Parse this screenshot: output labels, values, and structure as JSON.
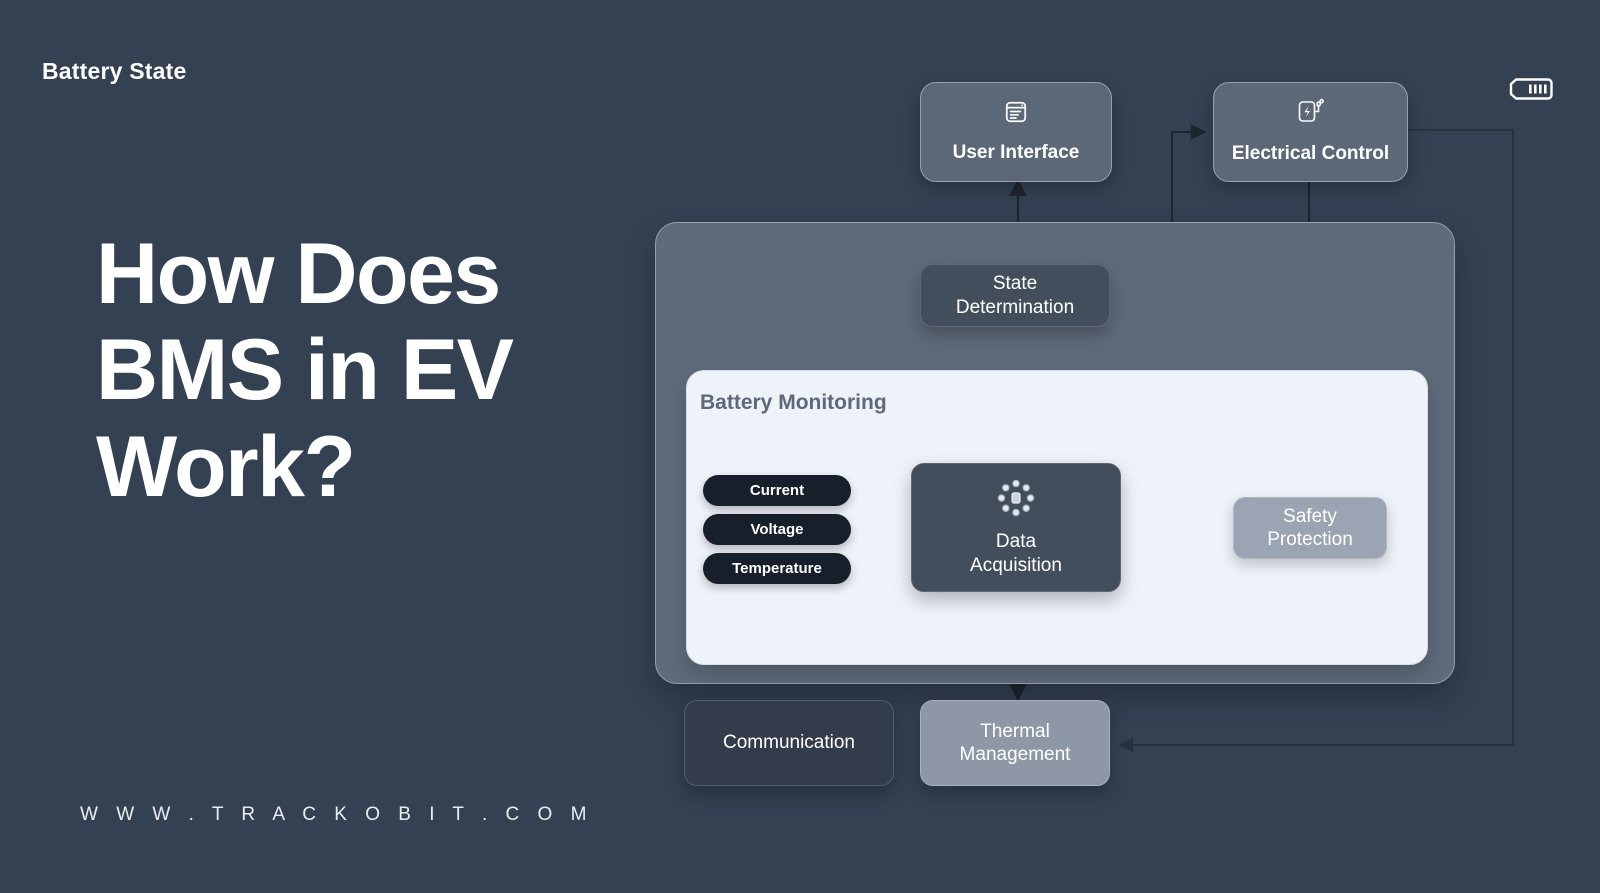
{
  "page": {
    "background_color": "#344152",
    "headline_lines": [
      "How Does",
      "BMS in EV",
      "Work?"
    ],
    "site_url": "W W W . T R A C K O B I T . C O M"
  },
  "diagram": {
    "container": {
      "title": "Battery State",
      "icon": "battery-icon"
    },
    "monitoring_panel": {
      "title": "Battery Monitoring",
      "sensors": [
        {
          "label": "Current"
        },
        {
          "label": "Voltage"
        },
        {
          "label": "Temperature"
        }
      ],
      "acquisition": {
        "label": "Data\nAcquisition",
        "icon": "network-hub-icon"
      },
      "safety": {
        "label": "Safety\nProtection"
      }
    },
    "nodes": {
      "user_interface": {
        "label": "User Interface",
        "icon": "window-document-icon"
      },
      "electrical_control": {
        "label": "Electrical Control",
        "icon": "battery-bolt-icon"
      },
      "state_determination": {
        "label": "State\nDetermination"
      },
      "communication": {
        "label": "Communication"
      },
      "thermal_management": {
        "label": "Thermal\nManagement"
      }
    },
    "colors": {
      "background": "#344152",
      "container_fill": "#5f6b7a",
      "panel_fill": "#eef2f9",
      "pill_fill": "#171f2b",
      "dark_node_fill": "#434e5d",
      "grey_node_fill": "#9aa4b2",
      "slate_node_fill": "#8d97a6",
      "wire_color": "#1d2530",
      "text_light": "#ffffff"
    }
  }
}
